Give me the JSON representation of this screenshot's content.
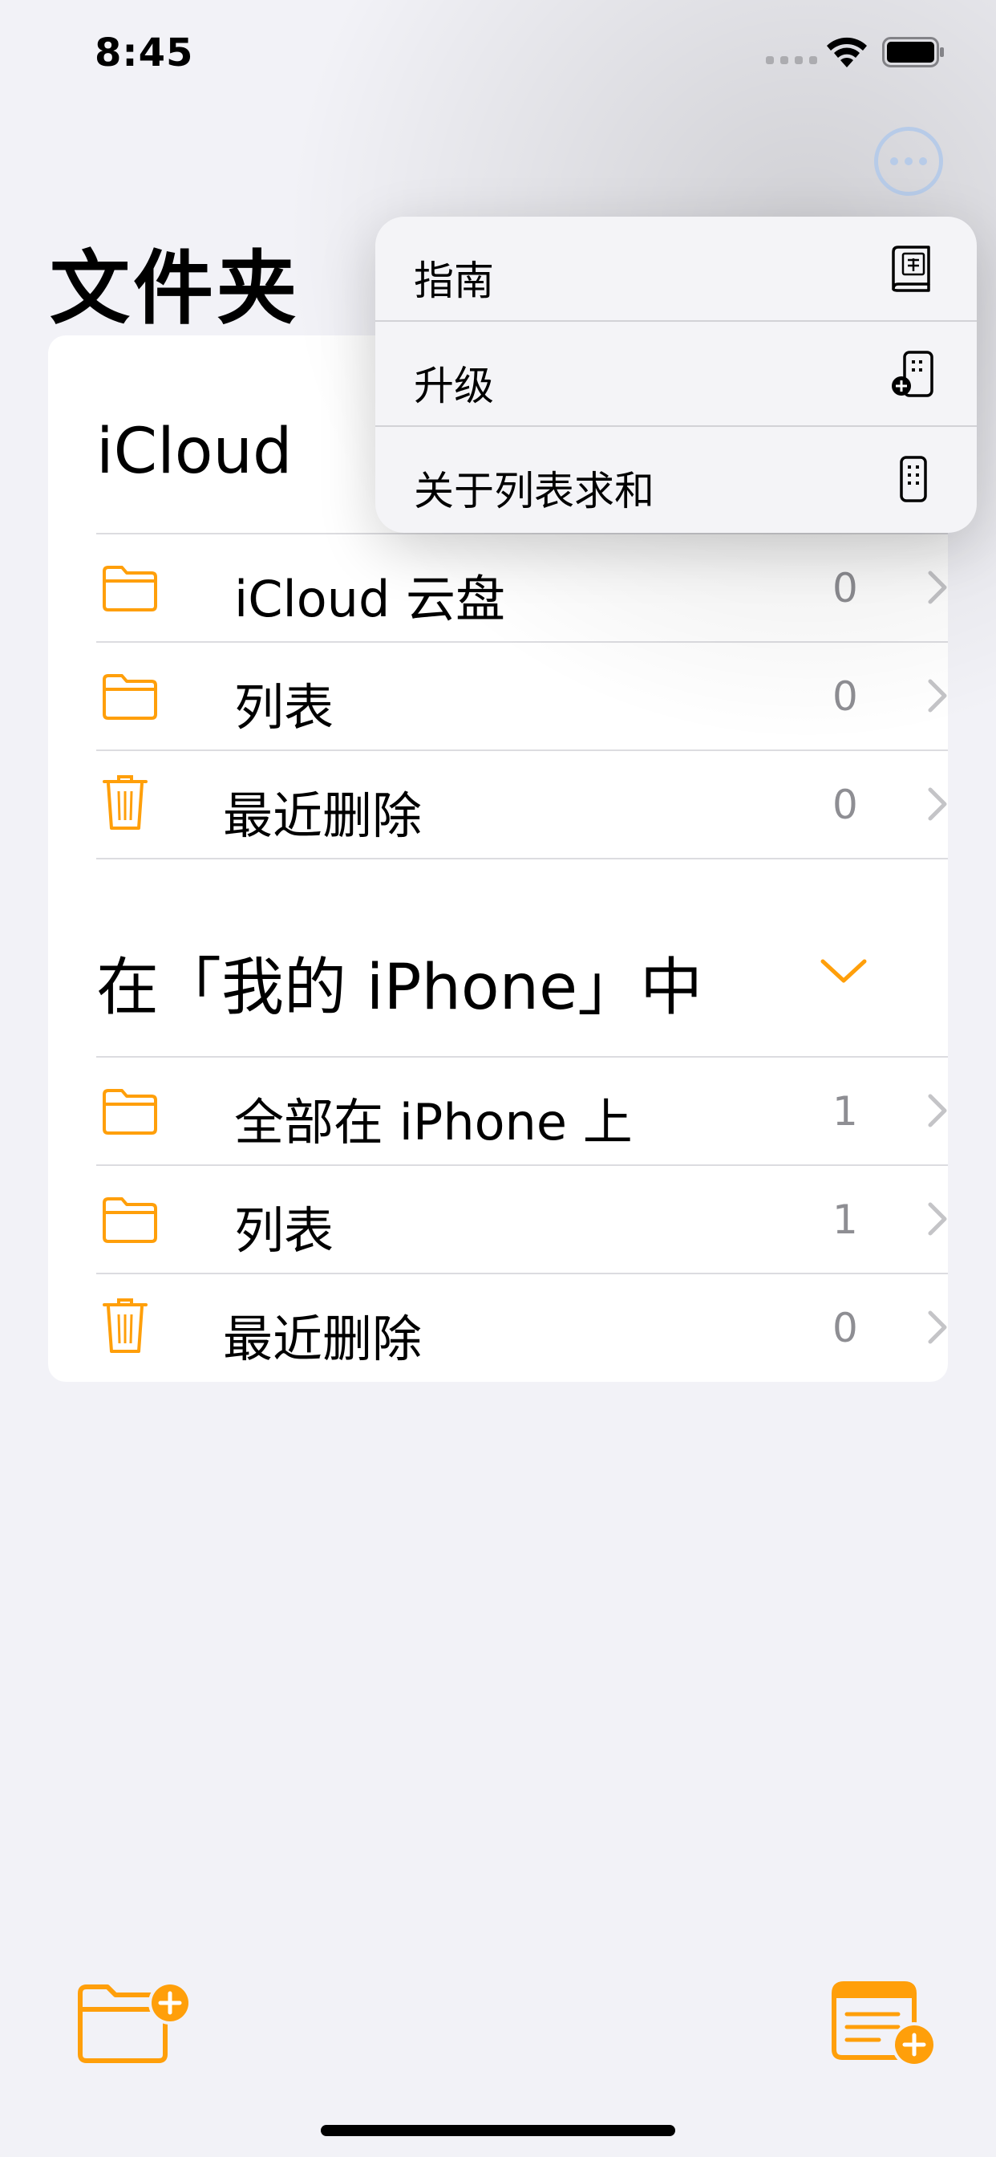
{
  "status_bar": {
    "time": "8:45"
  },
  "header": {
    "title": "文件夹"
  },
  "icloud_section": {
    "title": "iCloud",
    "rows": [
      {
        "label": "iCloud 云盘",
        "count": "0",
        "icon": "folder-icon"
      },
      {
        "label": "列表",
        "count": "0",
        "icon": "folder-icon"
      },
      {
        "label": "最近删除",
        "count": "0",
        "icon": "trash-icon"
      }
    ]
  },
  "local_section": {
    "title": "在「我的 iPhone」中",
    "rows": [
      {
        "label": "全部在 iPhone 上",
        "count": "1",
        "icon": "folder-icon"
      },
      {
        "label": "列表",
        "count": "1",
        "icon": "folder-icon"
      },
      {
        "label": "最近删除",
        "count": "0",
        "icon": "trash-icon"
      }
    ]
  },
  "menu": {
    "items": [
      {
        "label": "指南",
        "icon": "guide-book-icon"
      },
      {
        "label": "升级",
        "icon": "upgrade-device-icon"
      },
      {
        "label": "关于列表求和",
        "icon": "device-info-icon"
      }
    ]
  },
  "toolbar": {
    "left_icon": "new-folder-icon",
    "right_icon": "new-list-icon"
  },
  "colors": {
    "accent": "#FF9F0A",
    "background": "#F2F2F7",
    "secondary_text": "#8E8E93",
    "more_button": "#B7CBE8"
  }
}
